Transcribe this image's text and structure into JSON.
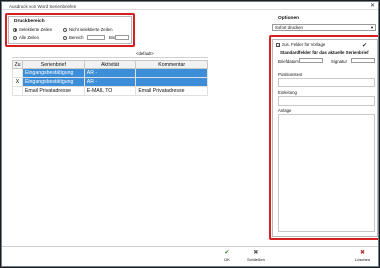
{
  "window": {
    "title": "Ausdruck von Word Serienbriefen",
    "close_glyph": "✕"
  },
  "druckbereich": {
    "title": "Druckbereich",
    "options": [
      {
        "label": "Selektierte Zeilen",
        "selected": true
      },
      {
        "label": "Nicht selektierte Zeilen",
        "selected": false
      },
      {
        "label": "Alle Zeilen",
        "selected": false
      },
      {
        "label": "Bereich",
        "selected": false
      }
    ],
    "bis_label": "Bis"
  },
  "default_label": "<default>",
  "optionen": {
    "title": "Optionen",
    "dropdown_value": "Sofort drucken",
    "checkbox_label": "zus. Felder für Vorlage",
    "checkbox_checked": true,
    "check_glyph": "✔"
  },
  "standardfelder": {
    "title": "Standardfelder für das aktuelle Serienbrief",
    "briefdatum_label": "Briefdatum",
    "signatur_label": "Signatur",
    "positionstext_label": "Positionstext",
    "einleitung_label": "Einleitung",
    "anlage_label": "Anlage"
  },
  "table": {
    "columns": [
      "Zu",
      "Serienbrief",
      "Aktivität",
      "Kommentar"
    ],
    "rows": [
      {
        "zu": "",
        "serienbrief": "Eingangsbestätigung",
        "aktivitaet": "AR -",
        "kommentar": "",
        "selected": true
      },
      {
        "zu": "X",
        "serienbrief": "Eingangsbestätigung",
        "aktivitaet": "AR -",
        "kommentar": "",
        "selected": true
      },
      {
        "zu": "",
        "serienbrief": "Email Privatadresse",
        "aktivitaet": "E-MAIL TO",
        "kommentar": "Email Privatadresse",
        "selected": false
      }
    ]
  },
  "buttons": {
    "ok": {
      "label": "OK",
      "icon": "check-icon",
      "glyph": "✔"
    },
    "schliessen": {
      "label": "Schließen",
      "icon": "close-icon",
      "glyph": "✖"
    },
    "loeschen": {
      "label": "Löschen",
      "icon": "delete-icon",
      "glyph": "✖"
    }
  },
  "colors": {
    "highlight": "#d42020",
    "selection": "#3d8ed9"
  }
}
